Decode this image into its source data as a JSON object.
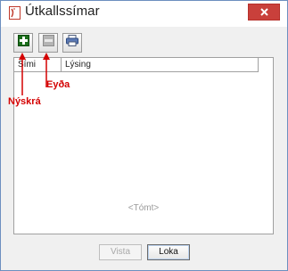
{
  "window": {
    "title": "Útkallssímar"
  },
  "toolbar": {
    "buttons": [
      {
        "icon": "add-icon",
        "color": "#1a9a1a"
      },
      {
        "icon": "remove-icon",
        "color": "#9a9a9a"
      },
      {
        "icon": "printer-icon",
        "color": "#3a5a9a"
      }
    ]
  },
  "grid": {
    "columns": [
      "Sími",
      "Lýsing"
    ],
    "empty_text": "<Tómt>"
  },
  "buttons": {
    "vista": "Vista",
    "loka": "Loka"
  },
  "annotations": {
    "delete_label": "Eyða",
    "new_label": "Nýskrá",
    "color": "#d40000"
  },
  "colors": {
    "close_button": "#c9403b",
    "window_border": "#6d8fbf"
  }
}
